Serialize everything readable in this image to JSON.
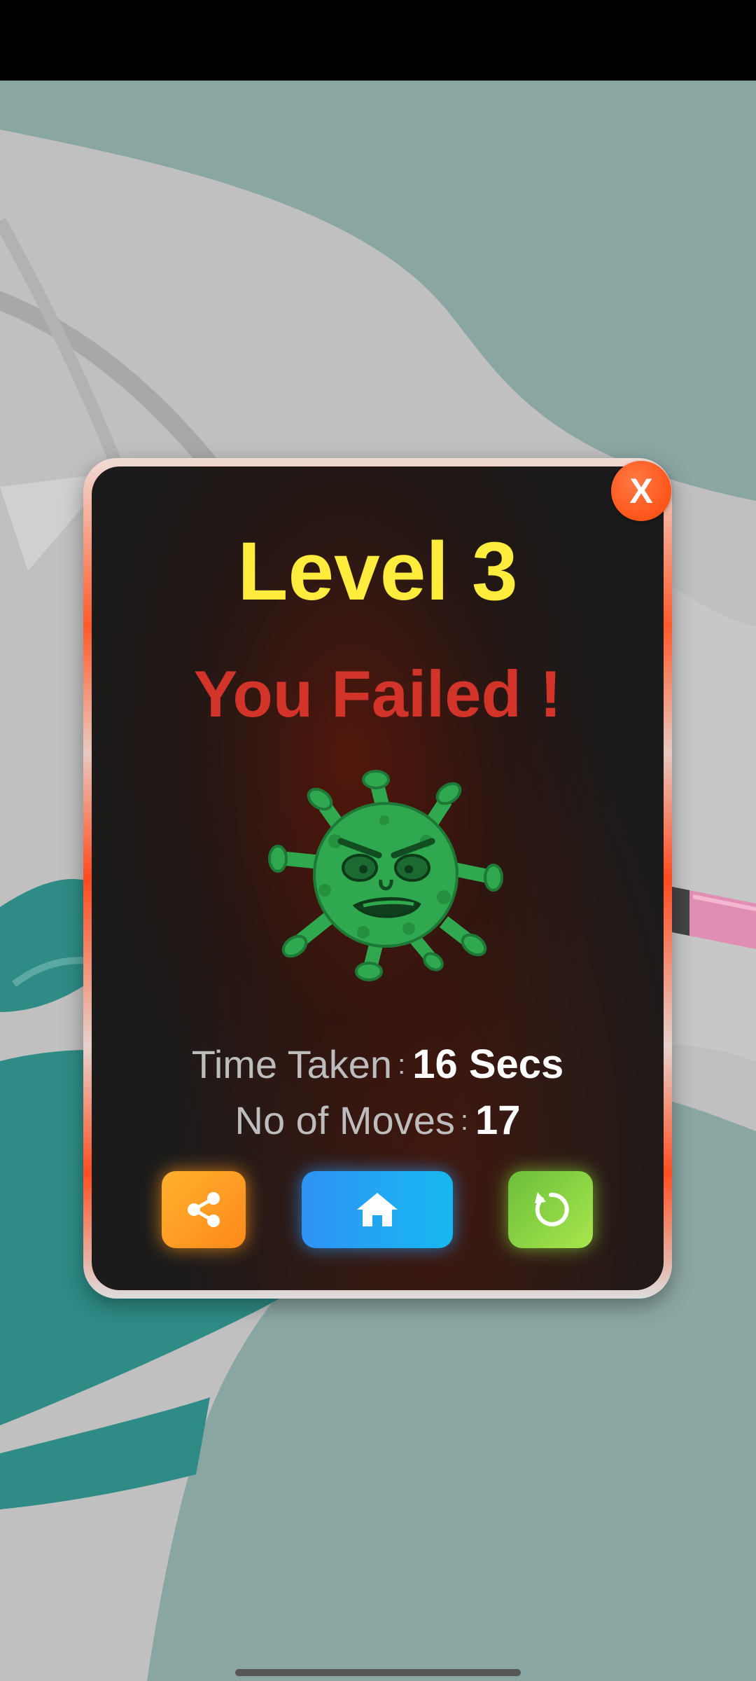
{
  "dialog": {
    "close_label": "X",
    "level_title": "Level 3",
    "result_text": "You Failed !",
    "result_icon": "angry-virus-icon",
    "stats": {
      "time_label": "Time Taken",
      "time_value": "16 Secs",
      "moves_label": "No of Moves",
      "moves_value": "17",
      "separator": ":"
    },
    "buttons": {
      "share_icon": "share-icon",
      "home_icon": "home-icon",
      "replay_icon": "replay-icon"
    }
  },
  "colors": {
    "title": "#ffec3d",
    "failed": "#d2342a",
    "close": "#ff5a1f",
    "share": "#ff9a22",
    "home": "#1fa5f3",
    "replay": "#8fd444",
    "background": "#8aa6a3"
  }
}
